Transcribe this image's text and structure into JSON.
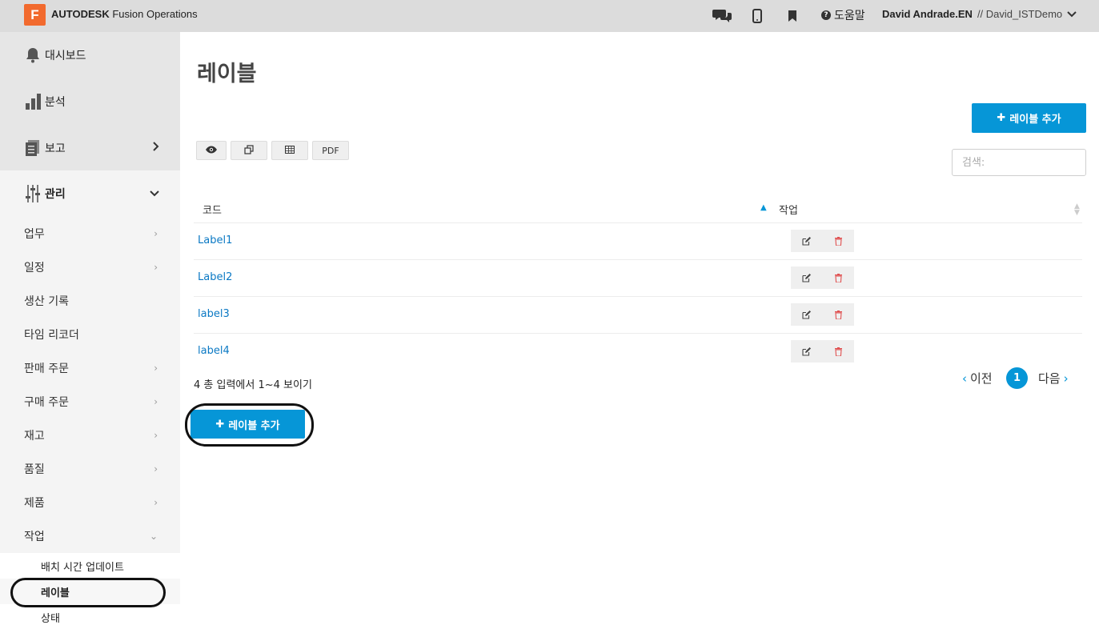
{
  "app": {
    "logo_letter": "F",
    "brand_bold": "AUTODESK",
    "brand_rest": "Fusion Operations",
    "help_label": "도움말",
    "user_name": "David Andrade.EN",
    "tenant": "// David_ISTDemo"
  },
  "sidebar": {
    "main": [
      {
        "label": "대시보드",
        "icon": "bell-icon"
      },
      {
        "label": "분석",
        "icon": "bar-chart-icon"
      },
      {
        "label": "보고",
        "icon": "document-icon"
      },
      {
        "label": "관리",
        "icon": "sliders-icon"
      }
    ],
    "sub": [
      "업무",
      "일정",
      "생산 기록",
      "타임 리코더",
      "판매 주문",
      "구매 주문",
      "재고",
      "품질",
      "제품",
      "작업"
    ],
    "leaves": [
      "배치 시간 업데이트",
      "레이블",
      "상태"
    ]
  },
  "page": {
    "title": "레이블",
    "add_label": "레이블 추가",
    "tools": {
      "pdf": "PDF"
    },
    "search_placeholder": "검색:",
    "columns": {
      "code": "코드",
      "action": "작업"
    },
    "rows": [
      "Label1",
      "Label2",
      "label3",
      "label4"
    ],
    "info": "4 총 입력에서 1~4 보이기",
    "pager": {
      "prev": "이전",
      "current": "1",
      "next": "다음"
    }
  },
  "colors": {
    "accent": "#0696d7",
    "logo": "#f26a2e",
    "delete": "#e05050"
  }
}
